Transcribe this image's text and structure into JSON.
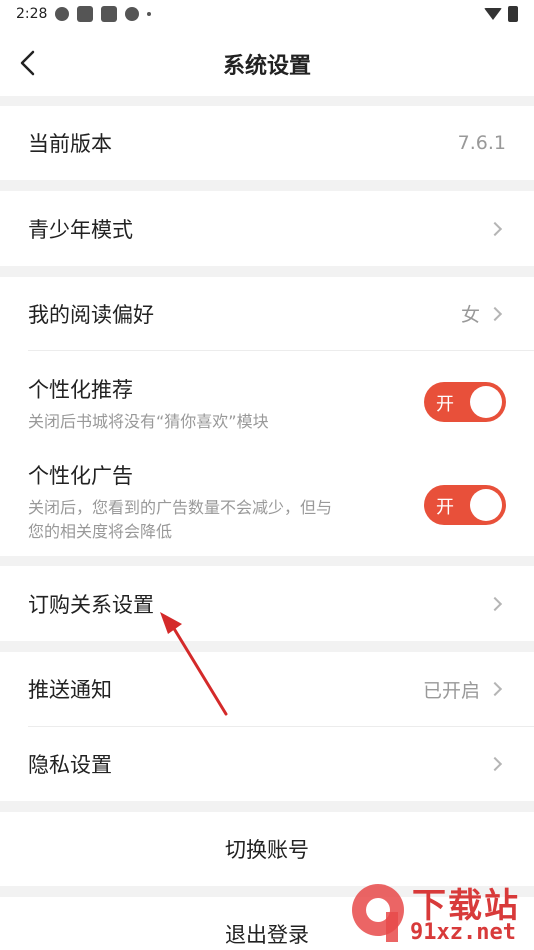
{
  "status_bar": {
    "time": "2:28"
  },
  "header": {
    "title": "系统设置"
  },
  "version_row": {
    "label": "当前版本",
    "value": "7.6.1"
  },
  "teen_row": {
    "label": "青少年模式"
  },
  "reading_row": {
    "label": "我的阅读偏好",
    "value": "女"
  },
  "personal_rec": {
    "title": "个性化推荐",
    "desc": "关闭后书城将没有“猜你喜欢”模块",
    "toggle_label": "开",
    "on": true
  },
  "personal_ad": {
    "title": "个性化广告",
    "desc_line1": "关闭后，您看到的广告数量不会减少，但与",
    "desc_line2": "您的相关度将会降低",
    "toggle_label": "开",
    "on": true
  },
  "subscription_row": {
    "label": "订购关系设置"
  },
  "push_row": {
    "label": "推送通知",
    "value": "已开启"
  },
  "privacy_row": {
    "label": "隐私设置"
  },
  "switch_account": {
    "label": "切换账号"
  },
  "logout": {
    "label": "退出登录"
  },
  "watermark": {
    "top": "下载站",
    "bottom": "91xz.net"
  },
  "colors": {
    "accent": "#e8503a",
    "annotation": "#d42a2a"
  }
}
